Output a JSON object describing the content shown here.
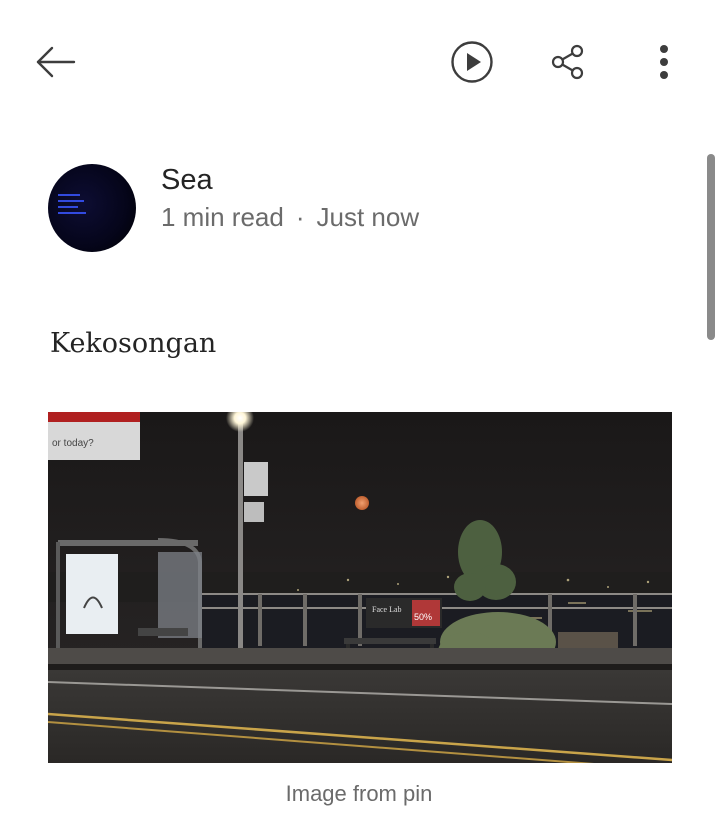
{
  "header": {
    "back_icon": "arrow-left-icon",
    "play_icon": "play-circle-icon",
    "share_icon": "share-icon",
    "more_icon": "more-vertical-icon"
  },
  "author": {
    "name": "Sea",
    "read_time": "1 min read",
    "separator": "·",
    "posted": "Just now"
  },
  "story": {
    "text": "Kekosongan"
  },
  "image": {
    "caption": "Image from pin",
    "sign_text": "or today?",
    "shop_sign": "Face Lab",
    "sale_sign": "50%"
  },
  "colors": {
    "text_primary": "#242424",
    "text_secondary": "#6b6b6b",
    "scrollbar": "#8a8a8a"
  }
}
